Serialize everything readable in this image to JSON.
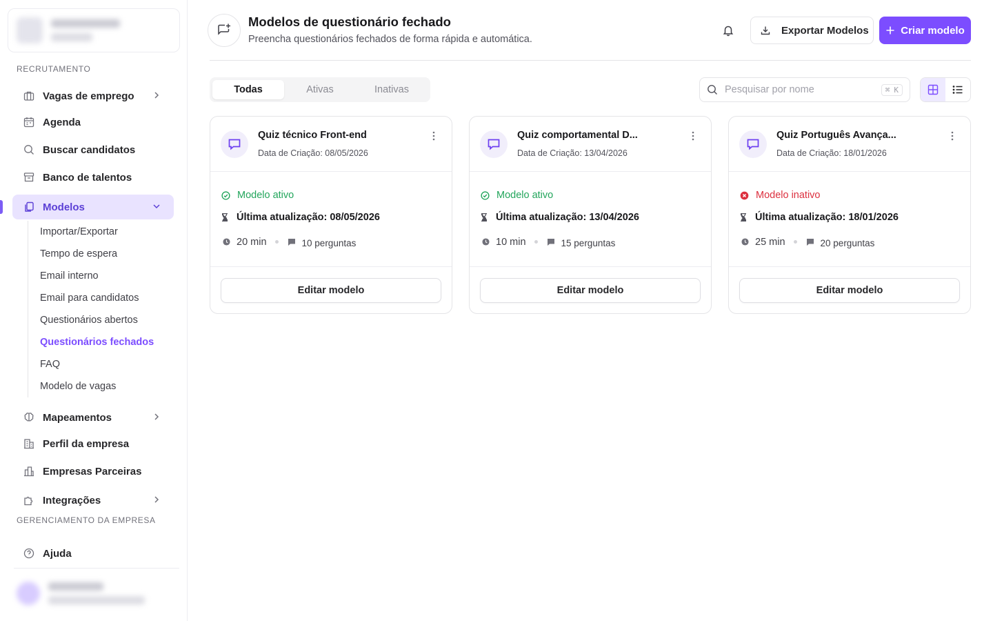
{
  "sidebar": {
    "sections": {
      "recruitment": "RECRUTAMENTO",
      "company": "GERENCIAMENTO DA EMPRESA"
    },
    "items": {
      "vagas": "Vagas de emprego",
      "agenda": "Agenda",
      "buscar": "Buscar candidatos",
      "banco": "Banco de talentos",
      "modelos": "Modelos",
      "mapeamentos": "Mapeamentos",
      "perfil": "Perfil da empresa",
      "parceiras": "Empresas Parceiras",
      "integracoes": "Integrações",
      "ajuda": "Ajuda"
    },
    "subitems": [
      "Importar/Exportar",
      "Tempo de espera",
      "Email interno",
      "Email para candidatos",
      "Questionários abertos",
      "Questionários fechados",
      "FAQ",
      "Modelo de vagas"
    ],
    "current_subitem": "Questionários fechados"
  },
  "header": {
    "title": "Modelos de questionário fechado",
    "subtitle": "Preencha questionários fechados de forma rápida e automática.",
    "export_label": "Exportar Modelos",
    "create_label": "Criar modelo"
  },
  "toolbar": {
    "tabs": [
      "Todas",
      "Ativas",
      "Inativas"
    ],
    "active_tab": "Todas",
    "search_placeholder": "Pesquisar por nome",
    "shortcut_symbol": "⌘",
    "shortcut_key": "K",
    "view_mode": "grid"
  },
  "cards": [
    {
      "title": "Quiz técnico Front-end",
      "created": "Data de Criação: 08/05/2026",
      "status": "Modelo ativo",
      "active": true,
      "updated": "Última atualização: 08/05/2026",
      "duration": "20 min",
      "questions": "10 perguntas",
      "edit_label": "Editar modelo"
    },
    {
      "title": "Quiz comportamental D...",
      "created": "Data de Criação: 13/04/2026",
      "status": "Modelo ativo",
      "active": true,
      "updated": "Última atualização: 13/04/2026",
      "duration": "10 min",
      "questions": "15 perguntas",
      "edit_label": "Editar modelo"
    },
    {
      "title": "Quiz Português Avança...",
      "created": "Data de Criação: 18/01/2026",
      "status": "Modelo inativo",
      "active": false,
      "updated": "Última atualização: 18/01/2026",
      "duration": "25 min",
      "questions": "20 perguntas",
      "edit_label": "Editar modelo"
    }
  ],
  "colors": {
    "accent": "#7c4dff",
    "active_nav_bg": "#e9e3ff",
    "status_active": "#22a55b",
    "status_inactive": "#dc2f3e"
  },
  "icons": {
    "page": "message-plus-icon",
    "bell": "bell-icon",
    "export": "download-icon",
    "create": "plus-icon",
    "search": "search-icon",
    "grid": "grid-icon",
    "list": "list-icon",
    "card": "message-square-icon",
    "kebab": "more-vertical-icon",
    "active_status": "check-circle-icon",
    "inactive_status": "x-circle-icon",
    "updated": "hourglass-icon",
    "duration": "clock-icon",
    "questions": "message-icon"
  }
}
